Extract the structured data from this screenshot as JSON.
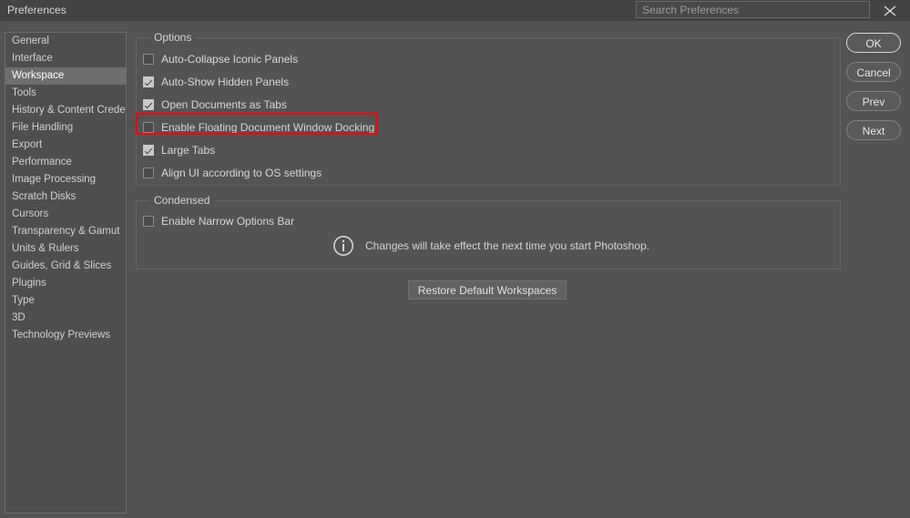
{
  "titlebar": {
    "title": "Preferences",
    "search_placeholder": "Search Preferences",
    "search_value": "",
    "close_label": "close-icon"
  },
  "sidebar": {
    "items": [
      {
        "label": "General",
        "selected": false
      },
      {
        "label": "Interface",
        "selected": false
      },
      {
        "label": "Workspace",
        "selected": true
      },
      {
        "label": "Tools",
        "selected": false
      },
      {
        "label": "History & Content Credentials",
        "selected": false
      },
      {
        "label": "File Handling",
        "selected": false
      },
      {
        "label": "Export",
        "selected": false
      },
      {
        "label": "Performance",
        "selected": false
      },
      {
        "label": "Image Processing",
        "selected": false
      },
      {
        "label": "Scratch Disks",
        "selected": false
      },
      {
        "label": "Cursors",
        "selected": false
      },
      {
        "label": "Transparency & Gamut",
        "selected": false
      },
      {
        "label": "Units & Rulers",
        "selected": false
      },
      {
        "label": "Guides, Grid & Slices",
        "selected": false
      },
      {
        "label": "Plugins",
        "selected": false
      },
      {
        "label": "Type",
        "selected": false
      },
      {
        "label": "3D",
        "selected": false
      },
      {
        "label": "Technology Previews",
        "selected": false
      }
    ]
  },
  "options_group": {
    "legend": "Options",
    "checkboxes": [
      {
        "label": "Auto-Collapse Iconic Panels",
        "checked": false,
        "highlighted": false
      },
      {
        "label": "Auto-Show Hidden Panels",
        "checked": true,
        "highlighted": false
      },
      {
        "label": "Open Documents as Tabs",
        "checked": true,
        "highlighted": false
      },
      {
        "label": "Enable Floating Document Window Docking",
        "checked": false,
        "highlighted": true
      },
      {
        "label": "Large Tabs",
        "checked": true,
        "highlighted": false
      },
      {
        "label": "Align UI according to OS settings",
        "checked": false,
        "highlighted": false
      }
    ]
  },
  "condensed_group": {
    "legend": "Condensed",
    "checkboxes": [
      {
        "label": "Enable Narrow Options Bar",
        "checked": false,
        "highlighted": false
      }
    ]
  },
  "info_note": {
    "icon": "info-circle-icon",
    "text": "Changes will take effect the next time you start Photoshop."
  },
  "restore_button": {
    "label": "Restore Default Workspaces"
  },
  "action_buttons": [
    {
      "label": "OK",
      "primary": true
    },
    {
      "label": "Cancel",
      "primary": false
    },
    {
      "label": "Prev",
      "primary": false
    },
    {
      "label": "Next",
      "primary": false
    }
  ],
  "colors": {
    "titlebar_bg": "#434343",
    "dialog_bg": "#535353",
    "sidebar_bg": "#4e4e4e",
    "selection_bg": "#6e6e6e",
    "text": "#d4d4d4",
    "highlight_outline": "#ff0000"
  }
}
